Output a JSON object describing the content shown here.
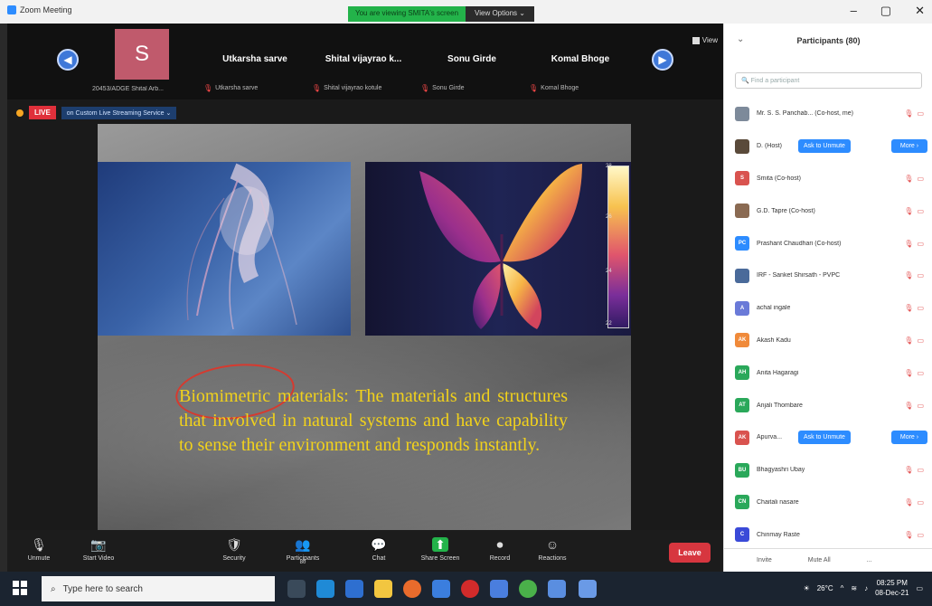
{
  "window": {
    "title": "Zoom Meeting",
    "controls": [
      "–",
      "▢",
      "✕"
    ]
  },
  "banner": {
    "viewing": "You are viewing SMITA's screen",
    "view_options": "View Options ⌄"
  },
  "video_strip": {
    "tiles": [
      {
        "avatar_letter": "S",
        "caption": "20453/ADGE Shital Arb..."
      },
      {
        "name": "Utkarsha sarve",
        "caption": "Utkarsha sarve"
      },
      {
        "name": "Shital vijayrao k...",
        "caption": "Shital vijayrao kotule"
      },
      {
        "name": "Sonu Girde",
        "caption": "Sonu Girde"
      },
      {
        "name": "Komal Bhoge",
        "caption": "Komal Bhoge"
      }
    ],
    "view_label": "View"
  },
  "live": {
    "badge": "LIVE",
    "service": "on Custom Live Streaming Service ⌄"
  },
  "slide": {
    "colorbar_ticks": [
      "28",
      "26",
      "24",
      "22"
    ],
    "text_term": "Biomimetric",
    "text_rest": " materials: The materials and structures that involved in natural systems and have capability to sense their environment and responds instantly."
  },
  "toolbar": {
    "items": [
      {
        "label": "Unmute",
        "icon": "🎙"
      },
      {
        "label": "Start Video",
        "icon": "📷"
      },
      {
        "label": "Security",
        "icon": "🛡"
      },
      {
        "label": "Participants",
        "icon": "👥"
      },
      {
        "label": "Chat",
        "icon": "💬"
      },
      {
        "label": "Share Screen",
        "icon": "⬆"
      },
      {
        "label": "Record",
        "icon": "⏺"
      },
      {
        "label": "Reactions",
        "icon": "☺"
      }
    ],
    "participants_count": "80",
    "leave": "Leave"
  },
  "panel": {
    "title": "Participants (80)",
    "search_placeholder": "Find a participant",
    "ask_label": "Ask to Unmute",
    "more_label": "More ›",
    "participants": [
      {
        "initials": "",
        "name": "Mr. S. S. Panchab... (Co-host, me)",
        "color": "#7d8a9a"
      },
      {
        "initials": "",
        "name": "D. (Host)",
        "color": "#5a4a3a"
      },
      {
        "initials": "S",
        "name": "Smita (Co-host)",
        "color": "#d9534f"
      },
      {
        "initials": "",
        "name": "G.D. Tapre (Co-host)",
        "color": "#8a6a52"
      },
      {
        "initials": "PC",
        "name": "Prashant Chaudhari (Co-host)",
        "color": "#2d8cff"
      },
      {
        "initials": "",
        "name": "IRF - Sanket Shirsath - PVPC",
        "color": "#4a6a9a"
      },
      {
        "initials": "A",
        "name": "achal ingale",
        "color": "#6a7ad8"
      },
      {
        "initials": "AK",
        "name": "Akash Kadu",
        "color": "#f08a3a"
      },
      {
        "initials": "AH",
        "name": "Anita Hagaragi",
        "color": "#2aa85a"
      },
      {
        "initials": "AT",
        "name": "Anjali Thombare",
        "color": "#2aa85a"
      },
      {
        "initials": "AK",
        "name": "Apurva...",
        "color": "#d9534f"
      },
      {
        "initials": "BU",
        "name": "Bhagyashri Ubay",
        "color": "#2aa85a"
      },
      {
        "initials": "CN",
        "name": "Chaitali nasare",
        "color": "#2aa85a"
      },
      {
        "initials": "C",
        "name": "Chinmay Raste",
        "color": "#3a4ad8"
      }
    ],
    "bottom": {
      "invite": "Invite",
      "mute_all": "Mute All",
      "more": "..."
    }
  },
  "taskbar": {
    "search_placeholder": "Type here to search",
    "weather": "26°C",
    "time": "08:25 PM",
    "date": "08-Dec-21"
  }
}
